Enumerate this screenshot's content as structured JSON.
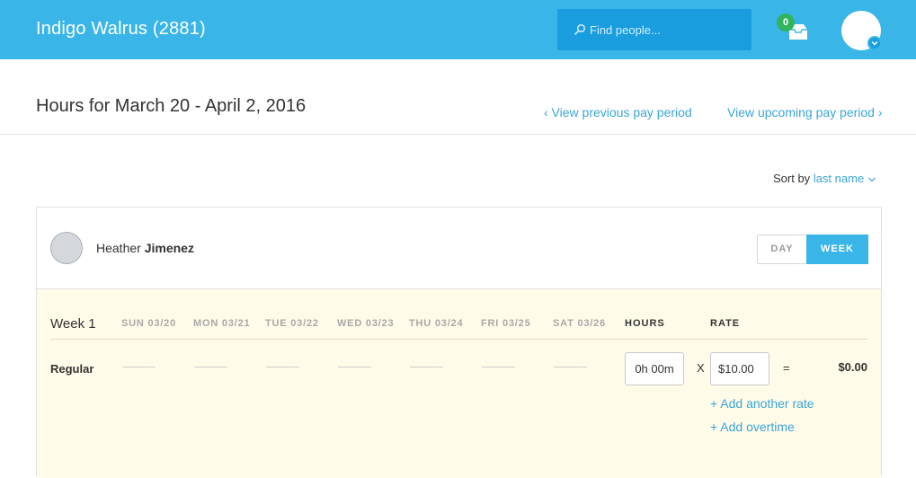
{
  "header": {
    "company": "Indigo Walrus (2881)",
    "search_placeholder": "Find people...",
    "inbox_count": "0",
    "colors": {
      "bar": "#3ab5e8",
      "search_bg": "#1a9ddf",
      "badge": "#32b45f"
    }
  },
  "page": {
    "title": "Hours for March 20 - April 2, 2016",
    "prev_link": "‹ View previous pay period",
    "next_link": "View upcoming pay period ›",
    "sort_label": "Sort by",
    "sort_value": "last name",
    "sort_chevron": "chevron-down-icon"
  },
  "employee": {
    "first_name": "Heather",
    "last_name": "Jimenez",
    "view_toggle": {
      "day": "DAY",
      "week": "WEEK",
      "selected": "WEEK"
    }
  },
  "timesheet": {
    "week_label": "Week 1",
    "days": [
      "SUN 03/20",
      "MON 03/21",
      "TUE 03/22",
      "WED 03/23",
      "THU 03/24",
      "FRI 03/25",
      "SAT 03/26"
    ],
    "hours_header": "HOURS",
    "rate_header": "RATE",
    "row_label": "Regular",
    "day_values": [
      "———",
      "———",
      "———",
      "———",
      "———",
      "———",
      "———"
    ],
    "hours_value": "0h 00m",
    "multiply": "X",
    "rate_value": "$10.00",
    "equals": "=",
    "total": "$0.00",
    "add_rate": "+ Add another rate",
    "add_overtime": "+ Add overtime"
  }
}
